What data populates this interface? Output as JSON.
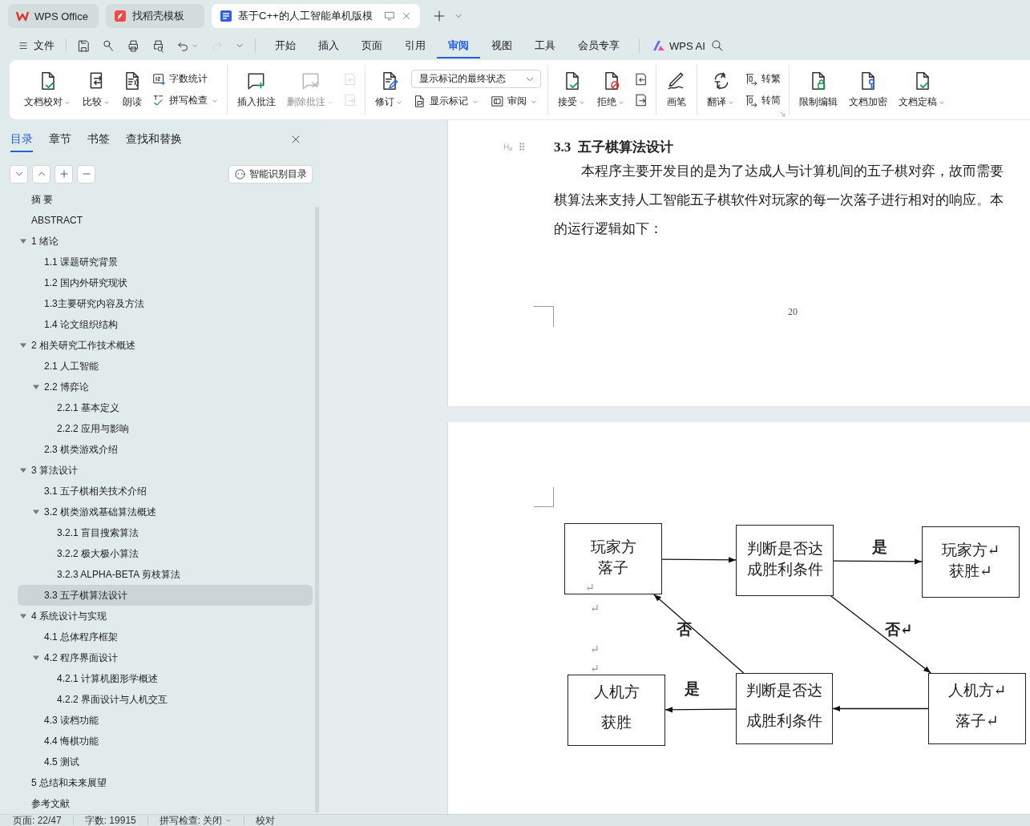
{
  "title_bar": {
    "tabs": [
      {
        "kind": "home",
        "label": "WPS Office",
        "selected": false
      },
      {
        "kind": "template",
        "label": "找稻壳模板",
        "selected": false
      },
      {
        "kind": "document",
        "label": "基于C++的人工智能单机版模",
        "selected": true
      }
    ]
  },
  "menu_bar": {
    "file": "文件",
    "quick_access": [
      {
        "kind": "save",
        "disabled": false,
        "dropdown": false
      },
      {
        "kind": "format-painter",
        "disabled": false,
        "dropdown": false
      },
      {
        "kind": "print",
        "disabled": false,
        "dropdown": false
      },
      {
        "kind": "print-preview",
        "disabled": false,
        "dropdown": false
      },
      {
        "kind": "undo",
        "disabled": false,
        "dropdown": true
      },
      {
        "kind": "redo",
        "disabled": true,
        "dropdown": false
      },
      {
        "kind": "more",
        "disabled": false,
        "dropdown": false
      }
    ],
    "tabs": [
      {
        "label": "开始",
        "selected": false
      },
      {
        "label": "插入",
        "selected": false
      },
      {
        "label": "页面",
        "selected": false
      },
      {
        "label": "引用",
        "selected": false
      },
      {
        "label": "审阅",
        "selected": true
      },
      {
        "label": "视图",
        "selected": false
      },
      {
        "label": "工具",
        "selected": false
      },
      {
        "label": "会员专享",
        "selected": false
      }
    ],
    "ai": "WPS AI"
  },
  "ribbon": {
    "groups": [
      {
        "launcher": false,
        "items": [
          {
            "kind": "large",
            "label": "文档校对",
            "dropdown": true,
            "disabled": false
          },
          {
            "kind": "large",
            "label": "比较",
            "dropdown": true,
            "disabled": false
          },
          {
            "kind": "large",
            "label": "朗读",
            "dropdown": false,
            "disabled": false
          },
          {
            "kind": "stack",
            "items": [
              {
                "kind": "small",
                "label": "字数统计",
                "dropdown": false,
                "disabled": false
              },
              {
                "kind": "small",
                "label": "拼写检查",
                "dropdown": true,
                "disabled": false
              }
            ]
          }
        ]
      },
      {
        "launcher": false,
        "items": [
          {
            "kind": "large",
            "label": "插入批注",
            "dropdown": false,
            "disabled": false
          },
          {
            "kind": "large",
            "label": "删除批注",
            "dropdown": true,
            "disabled": true
          },
          {
            "kind": "stack",
            "items": [
              {
                "kind": "icon",
                "dropdown": false,
                "disabled": true
              },
              {
                "kind": "icon",
                "dropdown": false,
                "disabled": true
              }
            ]
          }
        ]
      },
      {
        "launcher": false,
        "items": [
          {
            "kind": "large",
            "label": "修订",
            "dropdown": true,
            "disabled": false
          },
          {
            "kind": "stack",
            "items": [
              {
                "kind": "select",
                "value": "显示标记的最终状态"
              },
              {
                "kind": "row",
                "items": [
                  {
                    "kind": "small",
                    "label": "显示标记",
                    "dropdown": true,
                    "disabled": false
                  },
                  {
                    "kind": "small",
                    "label": "审阅",
                    "dropdown": true,
                    "disabled": false
                  }
                ]
              }
            ]
          }
        ]
      },
      {
        "launcher": false,
        "items": [
          {
            "kind": "large",
            "label": "接受",
            "dropdown": true,
            "disabled": false
          },
          {
            "kind": "large",
            "label": "拒绝",
            "dropdown": true,
            "disabled": false
          },
          {
            "kind": "stack",
            "items": [
              {
                "kind": "icon",
                "dropdown": false,
                "disabled": false
              },
              {
                "kind": "icon",
                "dropdown": false,
                "disabled": false
              }
            ]
          }
        ]
      },
      {
        "launcher": false,
        "items": [
          {
            "kind": "large",
            "label": "画笔",
            "dropdown": false,
            "disabled": false
          }
        ]
      },
      {
        "launcher": true,
        "items": [
          {
            "kind": "large",
            "label": "翻译",
            "dropdown": true,
            "disabled": false
          },
          {
            "kind": "stack",
            "items": [
              {
                "kind": "small",
                "label": "转繁",
                "dropdown": false,
                "disabled": false
              },
              {
                "kind": "small",
                "label": "转简",
                "dropdown": false,
                "disabled": false
              }
            ]
          }
        ]
      },
      {
        "launcher": false,
        "items": [
          {
            "kind": "large",
            "label": "限制编辑",
            "dropdown": false,
            "disabled": false
          },
          {
            "kind": "large",
            "label": "文档加密",
            "dropdown": false,
            "disabled": false
          },
          {
            "kind": "large",
            "label": "文档定稿",
            "dropdown": true,
            "disabled": false
          }
        ]
      }
    ]
  },
  "sidebar": {
    "tabs": [
      {
        "label": "目录",
        "selected": true
      },
      {
        "label": "章节",
        "selected": false
      },
      {
        "label": "书签",
        "selected": false
      },
      {
        "label": "查找和替换",
        "selected": false
      }
    ],
    "smart_toc": "智能识别目录",
    "outline": [
      {
        "label": "摘  要",
        "selected": false
      },
      {
        "label": "ABSTRACT",
        "selected": false
      },
      {
        "label": "1  绪论",
        "selected": false,
        "expanded": true,
        "children": [
          {
            "label": "1.1  课题研究背景",
            "selected": false
          },
          {
            "label": "1.2  国内外研究现状",
            "selected": false
          },
          {
            "label": "1.3主要研究内容及方法",
            "selected": false
          },
          {
            "label": "1.4  论文组织结构",
            "selected": false
          }
        ]
      },
      {
        "label": "2  相关研究工作技术概述",
        "selected": false,
        "expanded": true,
        "children": [
          {
            "label": "2.1  人工智能",
            "selected": false
          },
          {
            "label": "2.2  博弈论",
            "selected": false,
            "expanded": true,
            "children": [
              {
                "label": "2.2.1 基本定义",
                "selected": false
              },
              {
                "label": "2.2.2 应用与影响",
                "selected": false
              }
            ]
          },
          {
            "label": "2.3  棋类游戏介绍",
            "selected": false
          }
        ]
      },
      {
        "label": "3  算法设计",
        "selected": false,
        "expanded": true,
        "children": [
          {
            "label": "3.1  五子棋相关技术介绍",
            "selected": false
          },
          {
            "label": "3.2  棋类游戏基础算法概述",
            "selected": false,
            "expanded": true,
            "children": [
              {
                "label": "3.2.1  盲目搜索算法",
                "selected": false
              },
              {
                "label": "3.2.2  极大极小算法",
                "selected": false
              },
              {
                "label": "3.2.3 ALPHA-BETA 剪枝算法",
                "selected": false
              }
            ]
          },
          {
            "label": "3.3  五子棋算法设计",
            "selected": true
          }
        ]
      },
      {
        "label": "4  系统设计与实现",
        "selected": false,
        "expanded": true,
        "children": [
          {
            "label": "4.1  总体程序框架",
            "selected": false
          },
          {
            "label": "4.2  程序界面设计",
            "selected": false,
            "expanded": true,
            "children": [
              {
                "label": "4.2.1  计算机图形学概述",
                "selected": false
              },
              {
                "label": "4.2.2  界面设计与人机交互",
                "selected": false
              }
            ]
          },
          {
            "label": "4.3  读档功能",
            "selected": false
          },
          {
            "label": "4.4  悔棋功能",
            "selected": false
          },
          {
            "label": "4.5  测试",
            "selected": false
          }
        ]
      },
      {
        "label": "5  总结和未来展望",
        "selected": false
      },
      {
        "label": "参考文献",
        "selected": false
      }
    ]
  },
  "document": {
    "heading": "3.3  五子棋算法设计",
    "paragraph_lines": [
      "本程序主要开发目的是为了达成人与计算机间的五子棋对弈，故而需要",
      "棋算法来支持人工智能五子棋软件对玩家的每一次落子进行相对的响应。本",
      "的运行逻辑如下："
    ],
    "page_number": "20",
    "diagram": {
      "nodes": [
        {
          "lines": [
            "玩家方",
            "落子"
          ]
        },
        {
          "lines": [
            "判断是否达",
            "成胜利条件"
          ]
        },
        {
          "lines": [
            "玩家方↵",
            "获胜↵"
          ]
        },
        {
          "lines": [
            "人机方",
            "获胜"
          ]
        },
        {
          "lines": [
            "判断是否达",
            "成胜利条件"
          ]
        },
        {
          "lines": [
            "人机方↵",
            "落子↵"
          ]
        }
      ],
      "edges": [
        {
          "kind": "arrow"
        },
        {
          "kind": "arrow",
          "label": "是"
        },
        {
          "kind": "arrow",
          "label": "否↵"
        },
        {
          "kind": "arrow"
        },
        {
          "kind": "arrow",
          "label": "是"
        },
        {
          "kind": "arrow",
          "label": "否"
        }
      ],
      "paragraph_marks": [
        "↵",
        "↵",
        "↵",
        "↵"
      ]
    }
  },
  "status_bar": {
    "items": [
      {
        "label": "页面: 22/47",
        "dropdown": false
      },
      {
        "label": "字数: 19915",
        "dropdown": false
      },
      {
        "label": "拼写检查: 关闭",
        "dropdown": true
      },
      {
        "label": "校对",
        "dropdown": false
      }
    ]
  }
}
